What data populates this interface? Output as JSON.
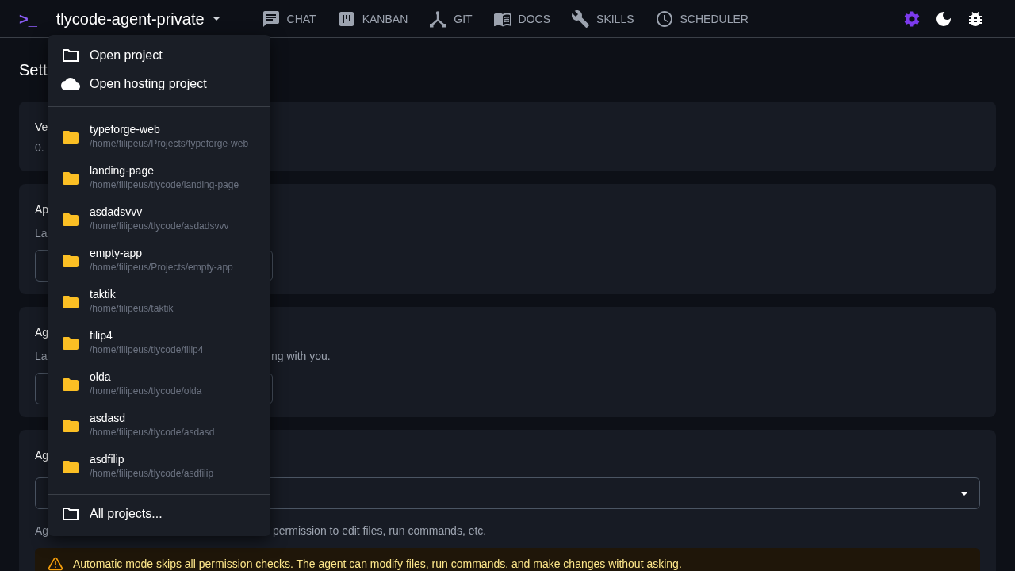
{
  "header": {
    "logo": ">_",
    "project": "tlycode-agent-private",
    "nav": [
      {
        "kind": "chat",
        "label": "CHAT"
      },
      {
        "kind": "kanban",
        "label": "KANBAN"
      },
      {
        "kind": "git",
        "label": "GIT"
      },
      {
        "kind": "docs",
        "label": "DOCS"
      },
      {
        "kind": "skills",
        "label": "SKILLS"
      },
      {
        "kind": "scheduler",
        "label": "SCHEDULER"
      }
    ],
    "actions": [
      {
        "kind": "settings",
        "selected": true
      },
      {
        "kind": "theme",
        "selected": false
      },
      {
        "kind": "debug",
        "selected": false
      }
    ]
  },
  "page": {
    "title": "Sett",
    "sections": [
      {
        "kind": "info",
        "title": "Ve",
        "value": "0."
      },
      {
        "kind": "select",
        "title": "Ap",
        "description": "La"
      },
      {
        "kind": "select",
        "title": "Ag",
        "description": "La",
        "description_tail": "ng with you."
      },
      {
        "kind": "wide",
        "title": "Ag",
        "description": "Ag",
        "description_tail": "permission to edit files, run commands, etc.",
        "warning": "Automatic mode skips all permission checks. The agent can modify files, run commands, and make changes without asking."
      }
    ]
  },
  "menu": {
    "actions": [
      {
        "kind": "folder",
        "label": "Open project"
      },
      {
        "kind": "cloud",
        "label": "Open hosting project"
      }
    ],
    "projects": [
      {
        "name": "typeforge-web",
        "path": "/home/filipeus/Projects/typeforge-web"
      },
      {
        "name": "landing-page",
        "path": "/home/filipeus/tlycode/landing-page"
      },
      {
        "name": "asdadsvvv",
        "path": "/home/filipeus/tlycode/asdadsvvv"
      },
      {
        "name": "empty-app",
        "path": "/home/filipeus/Projects/empty-app"
      },
      {
        "name": "taktik",
        "path": "/home/filipeus/taktik"
      },
      {
        "name": "filip4",
        "path": "/home/filipeus/tlycode/filip4"
      },
      {
        "name": "olda",
        "path": "/home/filipeus/tlycode/olda"
      },
      {
        "name": "asdasd",
        "path": "/home/filipeus/tlycode/asdasd"
      },
      {
        "name": "asdfilip",
        "path": "/home/filipeus/tlycode/asdfilip"
      }
    ],
    "footer": {
      "label": "All projects..."
    }
  }
}
